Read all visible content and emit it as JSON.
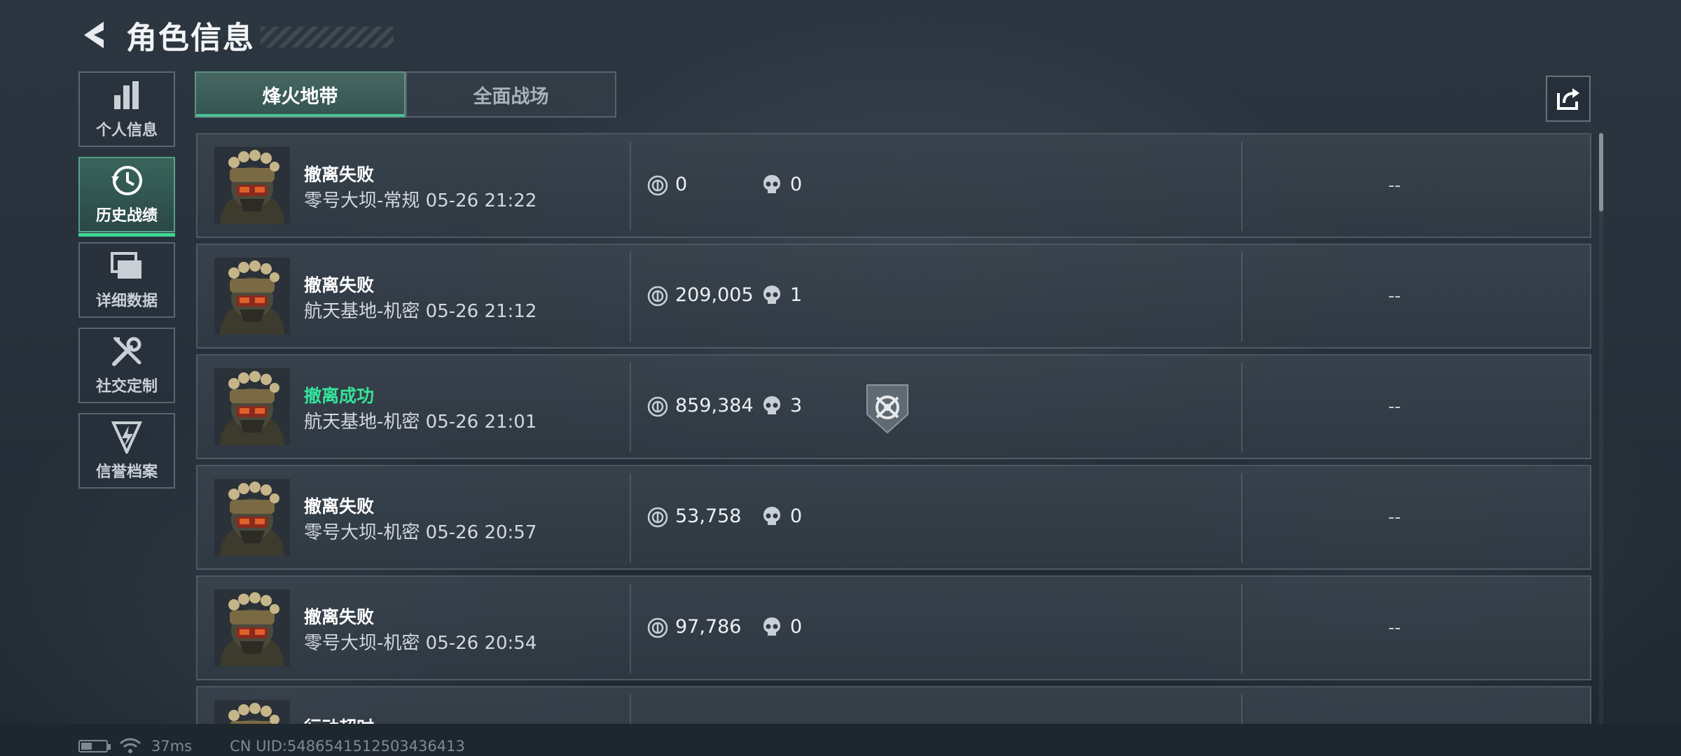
{
  "header": {
    "title": "角色信息",
    "back_icon": "back-arrow-icon"
  },
  "sidebar": {
    "items": [
      {
        "label": "个人信息",
        "icon": "bar-chart-icon",
        "active": false
      },
      {
        "label": "历史战绩",
        "icon": "history-clock-icon",
        "active": true
      },
      {
        "label": "详细数据",
        "icon": "folders-icon",
        "active": false
      },
      {
        "label": "社交定制",
        "icon": "tools-icon",
        "active": false
      },
      {
        "label": "信誉档案",
        "icon": "lightning-emblem-icon",
        "active": false
      }
    ]
  },
  "tabs": [
    {
      "label": "烽火地带",
      "active": true
    },
    {
      "label": "全面战场",
      "active": false
    }
  ],
  "share_icon": "share-icon",
  "matches": [
    {
      "result": "撤离失败",
      "success": false,
      "map_time": "零号大坝-常规 05-26 21:22",
      "money": "0",
      "kills": "0",
      "badge": false,
      "extra": "--"
    },
    {
      "result": "撤离失败",
      "success": false,
      "map_time": "航天基地-机密 05-26 21:12",
      "money": "209,005",
      "kills": "1",
      "badge": false,
      "extra": "--"
    },
    {
      "result": "撤离成功",
      "success": true,
      "map_time": "航天基地-机密 05-26 21:01",
      "money": "859,384",
      "kills": "3",
      "badge": true,
      "extra": "--"
    },
    {
      "result": "撤离失败",
      "success": false,
      "map_time": "零号大坝-机密 05-26 20:57",
      "money": "53,758",
      "kills": "0",
      "badge": false,
      "extra": "--"
    },
    {
      "result": "撤离失败",
      "success": false,
      "map_time": "零号大坝-机密 05-26 20:54",
      "money": "97,786",
      "kills": "0",
      "badge": false,
      "extra": "--"
    },
    {
      "result": "行动超时",
      "success": false,
      "map_time": "",
      "money": "",
      "kills": "",
      "badge": false,
      "extra": ""
    }
  ],
  "status_bar": {
    "battery_level": 0.45,
    "ping": "37ms",
    "uid": "CN UID:5486541512503436413"
  },
  "colors": {
    "accent": "#3fd896",
    "success": "#34e39a"
  }
}
